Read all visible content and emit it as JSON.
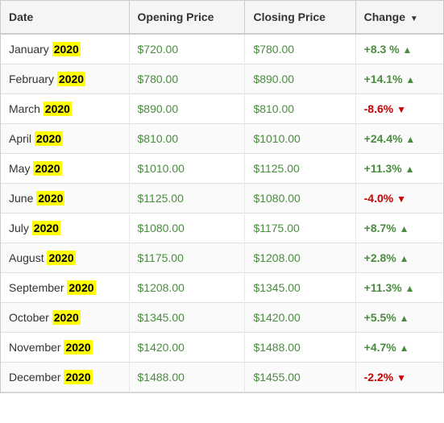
{
  "table": {
    "headers": {
      "date": "Date",
      "opening": "Opening Price",
      "closing": "Closing Price",
      "change": "Change"
    },
    "rows": [
      {
        "month": "January",
        "year": "2020",
        "opening": "$720.00",
        "closing": "$780.00",
        "change": "+8.3 %",
        "direction": "up"
      },
      {
        "month": "February",
        "year": "2020",
        "opening": "$780.00",
        "closing": "$890.00",
        "change": "+14.1%",
        "direction": "up"
      },
      {
        "month": "March",
        "year": "2020",
        "opening": "$890.00",
        "closing": "$810.00",
        "change": "-8.6%",
        "direction": "down"
      },
      {
        "month": "April",
        "year": "2020",
        "opening": "$810.00",
        "closing": "$1010.00",
        "change": "+24.4%",
        "direction": "up"
      },
      {
        "month": "May",
        "year": "2020",
        "opening": "$1010.00",
        "closing": "$1125.00",
        "change": "+11.3%",
        "direction": "up"
      },
      {
        "month": "June",
        "year": "2020",
        "opening": "$1125.00",
        "closing": "$1080.00",
        "change": "-4.0%",
        "direction": "down"
      },
      {
        "month": "July",
        "year": "2020",
        "opening": "$1080.00",
        "closing": "$1175.00",
        "change": "+8.7%",
        "direction": "up"
      },
      {
        "month": "August",
        "year": "2020",
        "opening": "$1175.00",
        "closing": "$1208.00",
        "change": "+2.8%",
        "direction": "up"
      },
      {
        "month": "September",
        "year": "2020",
        "opening": "$1208.00",
        "closing": "$1345.00",
        "change": "+11.3%",
        "direction": "up"
      },
      {
        "month": "October",
        "year": "2020",
        "opening": "$1345.00",
        "closing": "$1420.00",
        "change": "+5.5%",
        "direction": "up"
      },
      {
        "month": "November",
        "year": "2020",
        "opening": "$1420.00",
        "closing": "$1488.00",
        "change": "+4.7%",
        "direction": "up"
      },
      {
        "month": "December",
        "year": "2020",
        "opening": "$1488.00",
        "closing": "$1455.00",
        "change": "-2.2%",
        "direction": "down"
      }
    ]
  }
}
